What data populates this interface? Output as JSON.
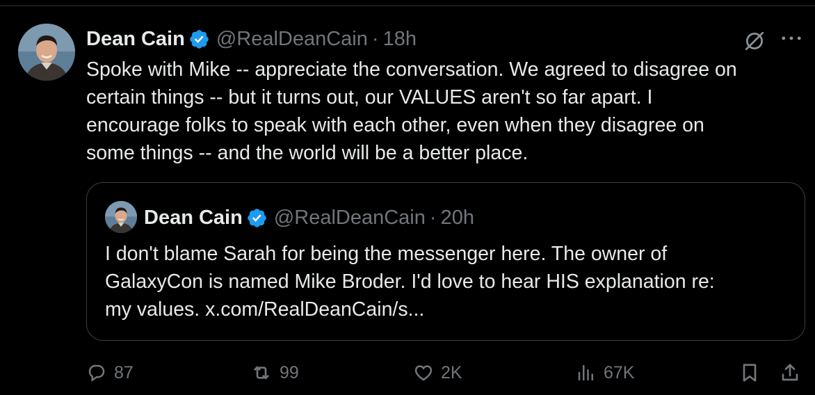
{
  "tweet": {
    "author_name": "Dean Cain",
    "handle": "@RealDeanCain",
    "separator": "·",
    "time": "18h",
    "text": "Spoke with Mike -- appreciate the conversation.  We agreed to disagree on\ncertain things -- but it turns out, our VALUES aren't so far apart.  I\nencourage folks to speak with each other, even when they disagree on\nsome things -- and the world will be a better place."
  },
  "quoted_tweet": {
    "author_name": "Dean Cain",
    "handle": "@RealDeanCain",
    "separator": "·",
    "time": "20h",
    "text": "I don't blame Sarah for being the messenger here.  The owner of\nGalaxyCon is named Mike Broder.   I'd love to hear HIS explanation re:\nmy values. x.com/RealDeanCain/s..."
  },
  "actions": {
    "replies": "87",
    "reposts": "99",
    "likes": "2K",
    "views": "67K"
  },
  "icons": [
    "verified-badge-icon",
    "grok-icon",
    "more-icon",
    "reply-icon",
    "repost-icon",
    "like-icon",
    "views-icon",
    "bookmark-icon",
    "share-icon"
  ],
  "colors": {
    "background": "#000000",
    "text_primary": "#e7e9ea",
    "text_secondary": "#71767b",
    "verified_blue": "#1d9bf0",
    "border": "#2f3336"
  }
}
